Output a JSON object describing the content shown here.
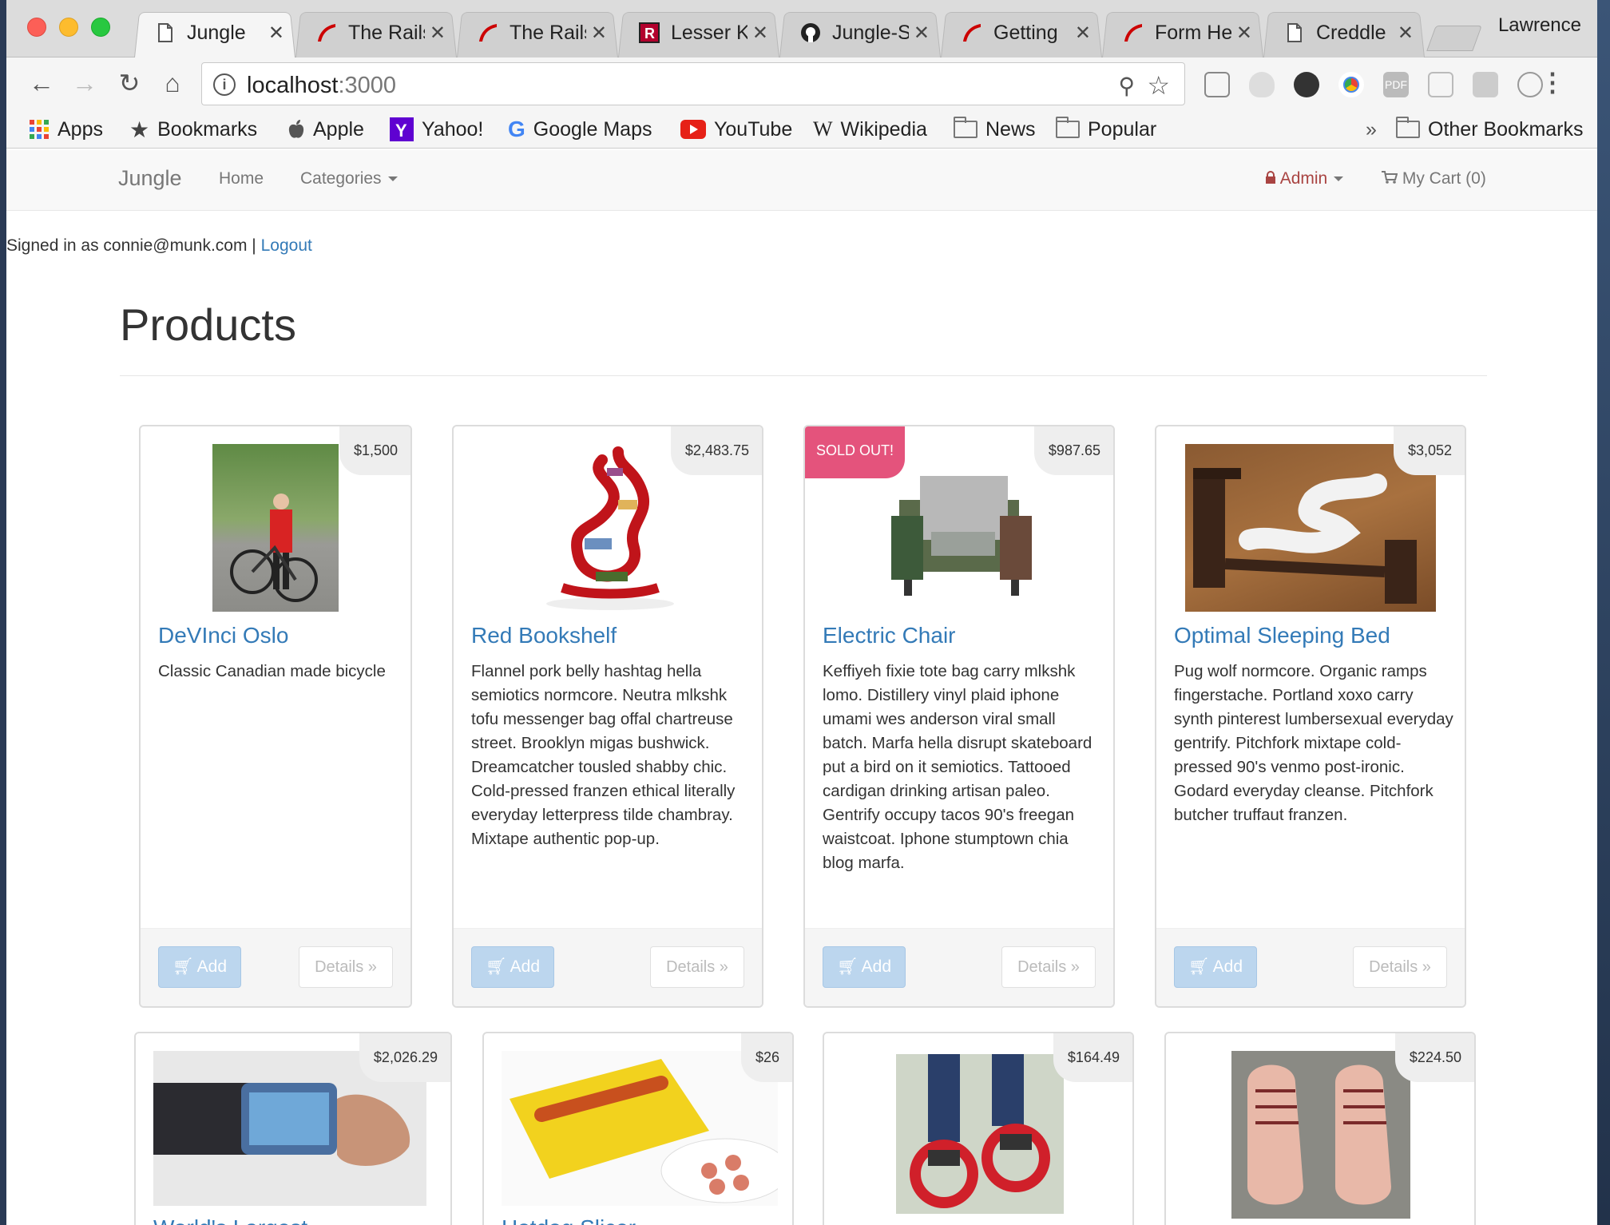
{
  "browser": {
    "tabs": [
      {
        "label": "Jungle",
        "icon": "page-icon",
        "active": true
      },
      {
        "label": "The Rails",
        "icon": "rails-icon"
      },
      {
        "label": "The Rails",
        "icon": "rails-icon"
      },
      {
        "label": "Lesser K",
        "icon": "r-icon"
      },
      {
        "label": "Jungle-S",
        "icon": "github-icon"
      },
      {
        "label": "Getting",
        "icon": "rails-icon"
      },
      {
        "label": "Form He",
        "icon": "rails-icon"
      },
      {
        "label": "Creddle",
        "icon": "page-icon"
      }
    ],
    "profile": "Lawrence",
    "url_host": "localhost",
    "url_port": ":3000",
    "bookmarks": [
      {
        "label": "Apps",
        "icon": "apps-grid-icon"
      },
      {
        "label": "Bookmarks",
        "icon": "star-icon"
      },
      {
        "label": "Apple",
        "icon": "apple-icon"
      },
      {
        "label": "Yahoo!",
        "icon": "yahoo-icon"
      },
      {
        "label": "Google Maps",
        "icon": "google-icon"
      },
      {
        "label": "YouTube",
        "icon": "youtube-icon"
      },
      {
        "label": "Wikipedia",
        "icon": "wikipedia-icon"
      },
      {
        "label": "News",
        "icon": "folder-icon"
      },
      {
        "label": "Popular",
        "icon": "folder-icon"
      }
    ],
    "overflow": "»",
    "other_bookmarks": "Other Bookmarks"
  },
  "nav": {
    "brand": "Jungle",
    "home": "Home",
    "categories": "Categories",
    "admin": "Admin",
    "cart": "My Cart (0)"
  },
  "session": {
    "signed_in_text": "Signed in as connie@munk.com |",
    "logout": "Logout"
  },
  "page": {
    "title": "Products"
  },
  "buttons": {
    "add": "Add",
    "details": "Details »",
    "sold_out": "SOLD OUT!"
  },
  "products": [
    {
      "name": "DeVInci Oslo",
      "price": "$1,500",
      "description": "Classic Canadian made bicycle"
    },
    {
      "name": "Red Bookshelf",
      "price": "$2,483.75",
      "description": "Flannel pork belly hashtag hella semiotics normcore. Neutra mlkshk tofu messenger bag offal chartreuse street. Brooklyn migas bushwick. Dreamcatcher tousled shabby chic. Cold-pressed franzen ethical literally everyday letterpress tilde chambray. Mixtape authentic pop-up."
    },
    {
      "name": "Electric Chair",
      "price": "$987.65",
      "sold_out": true,
      "description": "Keffiyeh fixie tote bag carry mlkshk lomo. Distillery vinyl plaid iphone umami wes anderson viral small batch. Marfa hella disrupt skateboard put a bird on it semiotics. Tattooed cardigan drinking artisan paleo. Gentrify occupy tacos 90's freegan waistcoat. Iphone stumptown chia blog marfa."
    },
    {
      "name": "Optimal Sleeping Bed",
      "price": "$3,052",
      "description": "Pug wolf normcore. Organic ramps fingerstache. Portland xoxo carry synth pinterest lumbersexual everyday gentrify. Pitchfork mixtape cold-pressed 90's venmo post-ironic. Godard everyday cleanse. Pitchfork butcher truffaut franzen."
    },
    {
      "name": "World's Largest",
      "price": "$2,026.29"
    },
    {
      "name": "Hotdog Slicer",
      "price": "$26"
    },
    {
      "price": "$164.49"
    },
    {
      "price": "$224.50"
    }
  ],
  "colors": {
    "link": "#337ab7",
    "sold_out": "#e4537c",
    "add_button": "#bcd6ee",
    "admin": "#a94442"
  }
}
